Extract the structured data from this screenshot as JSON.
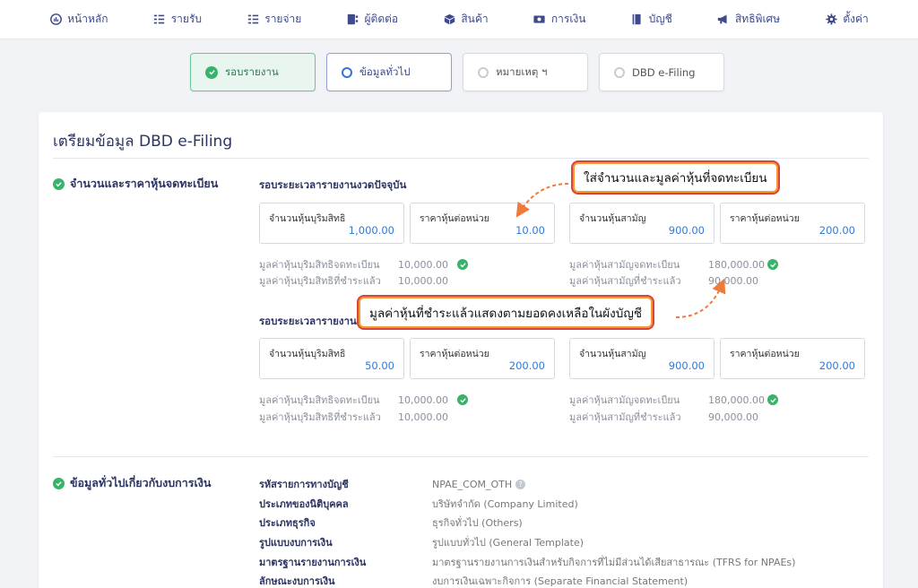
{
  "nav": [
    {
      "label": "หน้าหลัก",
      "icon": "dashboard-icon"
    },
    {
      "label": "รายรับ",
      "icon": "income-list-icon"
    },
    {
      "label": "รายจ่าย",
      "icon": "expense-list-icon"
    },
    {
      "label": "ผู้ติดต่อ",
      "icon": "contacts-icon"
    },
    {
      "label": "สินค้า",
      "icon": "product-box-icon"
    },
    {
      "label": "การเงิน",
      "icon": "money-icon"
    },
    {
      "label": "บัญชี",
      "icon": "ledger-icon"
    },
    {
      "label": "สิทธิพิเศษ",
      "icon": "megaphone-icon"
    },
    {
      "label": "ตั้งค่า",
      "icon": "gear-icon"
    }
  ],
  "steps": [
    {
      "label": "รอบรายงาน",
      "state": "done"
    },
    {
      "label": "ข้อมูลทั่วไป",
      "state": "active"
    },
    {
      "label": "หมายเหตุ ฯ",
      "state": "todo"
    },
    {
      "label": "DBD e-Filing",
      "state": "todo"
    }
  ],
  "page": {
    "title": "เตรียมข้อมูล DBD e-Filing"
  },
  "shares": {
    "section_title": "จำนวนและราคาหุ้นจดทะเบียน",
    "current": {
      "heading": "รอบระยะเวลารายงานงวดปัจจุบัน",
      "fields": [
        {
          "label": "จำนวนหุ้นบุริมสิทธิ",
          "value": "1,000.00"
        },
        {
          "label": "ราคาหุ้นต่อหน่วย",
          "value": "10.00"
        },
        {
          "label": "จำนวนหุ้นสามัญ",
          "value": "900.00"
        },
        {
          "label": "ราคาหุ้นต่อหน่วย",
          "value": "200.00"
        }
      ],
      "summary_left": [
        {
          "label": "มูลค่าหุ้นบุริมสิทธิจดทะเบียน",
          "value": "10,000.00",
          "check": true
        },
        {
          "label": "มูลค่าหุ้นบุริมสิทธิที่ชำระแล้ว",
          "value": "10,000.00",
          "check": false
        }
      ],
      "summary_right": [
        {
          "label": "มูลค่าหุ้นสามัญจดทะเบียน",
          "value": "180,000.00",
          "check": true
        },
        {
          "label": "มูลค่าหุ้นสามัญที่ชำระแล้ว",
          "value": "90,000.00",
          "check": false
        }
      ]
    },
    "previous": {
      "heading": "รอบระยะเวลารายงาน",
      "fields": [
        {
          "label": "จำนวนหุ้นบุริมสิทธิ",
          "value": "50.00"
        },
        {
          "label": "ราคาหุ้นต่อหน่วย",
          "value": "200.00"
        },
        {
          "label": "จำนวนหุ้นสามัญ",
          "value": "900.00"
        },
        {
          "label": "ราคาหุ้นต่อหน่วย",
          "value": "200.00"
        }
      ],
      "summary_left": [
        {
          "label": "มูลค่าหุ้นบุริมสิทธิจดทะเบียน",
          "value": "10,000.00",
          "check": true
        },
        {
          "label": "มูลค่าหุ้นบุริมสิทธิที่ชำระแล้ว",
          "value": "10,000.00",
          "check": false
        }
      ],
      "summary_right": [
        {
          "label": "มูลค่าหุ้นสามัญจดทะเบียน",
          "value": "180,000.00",
          "check": true
        },
        {
          "label": "มูลค่าหุ้นสามัญที่ชำระแล้ว",
          "value": "90,000.00",
          "check": false
        }
      ]
    }
  },
  "general": {
    "section_title": "ข้อมูลทั่วไปเกี่ยวกับงบการเงิน",
    "rows": [
      {
        "label": "รหัสรายการทางบัญชี",
        "value": "NPAE_COM_OTH",
        "help": true
      },
      {
        "label": "ประเภทของนิติบุคคล",
        "value": "บริษัทจำกัด (Company Limited)",
        "help": false
      },
      {
        "label": "ประเภทธุรกิจ",
        "value": "ธุรกิจทั่วไป (Others)",
        "help": false
      },
      {
        "label": "รูปแบบงบการเงิน",
        "value": "รูปแบบทั่วไป (General Template)",
        "help": false
      },
      {
        "label": "มาตรฐานรายงานการเงิน",
        "value": "มาตรฐานรายงานการเงินสำหรับกิจการที่ไม่มีส่วนได้เสียสาธารณะ (TFRS for NPAEs)",
        "help": false
      },
      {
        "label": "ลักษณะงบการเงิน",
        "value": "งบการเงินเฉพาะกิจการ (Separate Financial Statement)",
        "help": false
      }
    ]
  },
  "callouts": {
    "top": "ใส่จำนวนและมูลค่าหุ้นที่จดทะเบียน",
    "middle": "มูลค่าหุ้นที่ชำระแล้วแสดงตามยอดคงเหลือในผังบัญชี"
  },
  "colors": {
    "accent": "#3e4a8a",
    "value": "#2f7bd8",
    "success": "#38b36a",
    "callout_border": "#f29a38",
    "arrow": "#f07a3a"
  }
}
